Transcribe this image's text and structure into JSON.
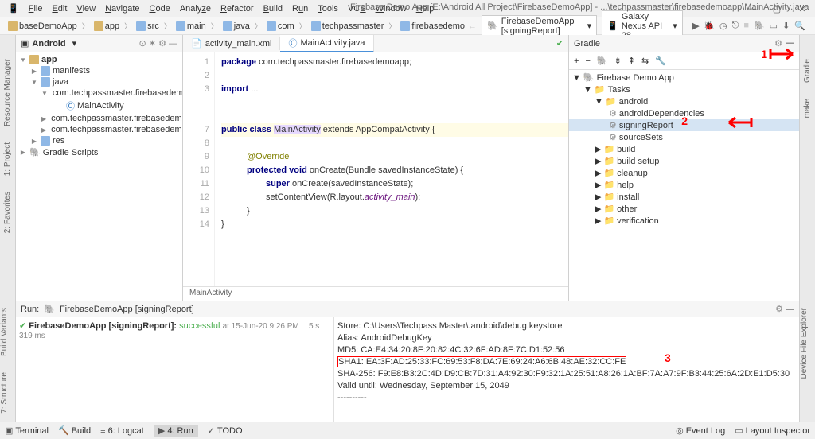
{
  "menu": {
    "file": "File",
    "edit": "Edit",
    "view": "View",
    "navigate": "Navigate",
    "code": "Code",
    "analyze": "Analyze",
    "refactor": "Refactor",
    "build": "Build",
    "run": "Run",
    "tools": "Tools",
    "vcs": "VCS",
    "window": "Window",
    "help": "Help"
  },
  "title": "Firebase Demo App [E:\\Android All Project\\FirebaseDemoApp] - ...\\techpassmaster\\firebasedemoapp\\MainActivity.java",
  "breadcrumb": [
    "baseDemoApp",
    "app",
    "src",
    "main",
    "java",
    "com",
    "techpassmaster",
    "firebasedemo"
  ],
  "runconfig": "FirebaseDemoApp [signingReport]",
  "emulator": "Galaxy Nexus API 28",
  "project": {
    "header": "Android",
    "nodes": {
      "app": "app",
      "manifests": "manifests",
      "java": "java",
      "pkg1": "com.techpassmaster.firebasedemoapp",
      "main": "MainActivity",
      "pkg2": "com.techpassmaster.firebasedemoapp (an",
      "pkg3": "com.techpassmaster.firebasedemoapp (te",
      "res": "res",
      "gradle": "Gradle Scripts"
    }
  },
  "tabs": {
    "xml": "activity_main.xml",
    "java": "MainActivity.java"
  },
  "code": {
    "l1": "package com.techpassmaster.firebasedemoapp;",
    "l3": "import ...",
    "l7a": "public class ",
    "l7b": "MainActivity",
    "l7c": " extends AppCompatActivity {",
    "l9": "@Override",
    "l10a": "protected void ",
    "l10b": "onCreate",
    "l10c": "(Bundle savedInstanceState) {",
    "l11": "super.onCreate(savedInstanceState);",
    "l12a": "setContentView(R.layout.",
    "l12b": "activity_main",
    "l12c": ");",
    "l13": "}",
    "l14": "}"
  },
  "crumb_class": "MainActivity",
  "gradle": {
    "title": "Gradle",
    "root": "Firebase Demo App",
    "tasks": "Tasks",
    "android": "android",
    "t1": "androidDependencies",
    "t2": "signingReport",
    "t3": "sourceSets",
    "g1": "build",
    "g2": "build setup",
    "g3": "cleanup",
    "g4": "help",
    "g5": "install",
    "g6": "other",
    "g7": "verification"
  },
  "sidebars": {
    "left1": "Resource Manager",
    "left2": "1: Project",
    "left3": "2: Favorites",
    "left4": "Build Variants",
    "left5": "7: Structure",
    "right1": "Gradle",
    "right2": "make",
    "right3": "Device File Explorer"
  },
  "run": {
    "label": "Run:",
    "cfg": "FirebaseDemoApp [signingReport]",
    "status": "FirebaseDemoApp [signingReport]: successful",
    "time": "at 15-Jun-20 9:26 PM",
    "dur": "5 s 319 ms",
    "out": {
      "store": "Store: C:\\Users\\Techpass Master\\.android\\debug.keystore",
      "alias": "Alias: AndroidDebugKey",
      "md5": "MD5: CA:E4:34:20:8F:20:82:4C:32:6F:AD:8F:7C:D1:52:56",
      "sha1": "SHA1: EA:3F:AD:25:33:FC:69:53:F8:DA:7E:69:24:A6:6B:48:AE:32:CC:FE",
      "sha256": "SHA-256: F9:E8:B3:2C:4D:D9:CB:7D:31:A4:92:30:F9:32:1A:25:51:A8:26:1A:BF:7A:A7:9F:B3:44:25:6A:2D:E1:D5:30",
      "valid": "Valid until: Wednesday, September 15, 2049",
      "dash": "----------"
    }
  },
  "status": {
    "terminal": "Terminal",
    "build": "Build",
    "logcat": "6: Logcat",
    "run": "4: Run",
    "todo": "TODO",
    "eventlog": "Event Log",
    "layout": "Layout Inspector"
  },
  "annot": {
    "n1": "1",
    "n2": "2",
    "n3": "3"
  }
}
